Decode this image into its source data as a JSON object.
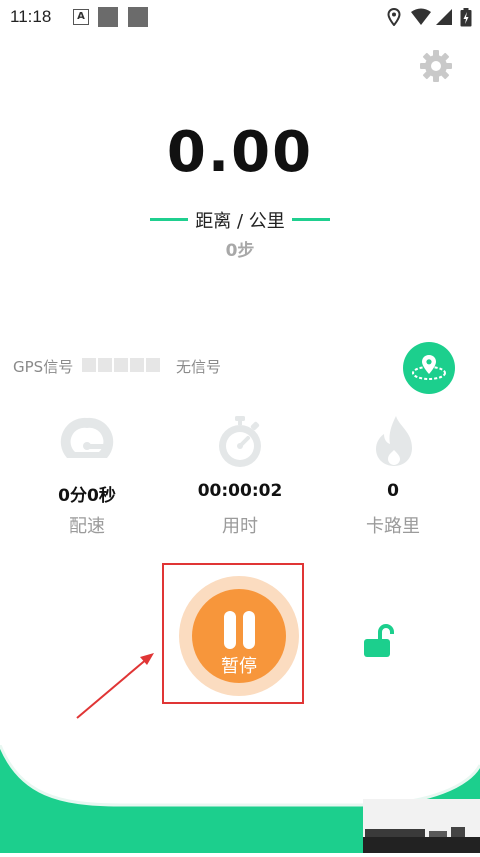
{
  "status_bar": {
    "time": "11:18",
    "keyboard_badge": "A",
    "icons": [
      "location-icon",
      "wifi-icon",
      "signal-icon",
      "battery-icon"
    ]
  },
  "settings": {
    "icon": "gear-icon"
  },
  "distance": {
    "value": "0.00",
    "unit_label": "距离 / 公里",
    "steps": "0步"
  },
  "gps": {
    "label": "GPS信号",
    "status": "无信号",
    "signal_level": 0,
    "signal_max": 5
  },
  "stats": [
    {
      "value": "0分0秒",
      "label": "配速",
      "icon": "speedometer-icon"
    },
    {
      "value": "00:00:02",
      "label": "用时",
      "icon": "stopwatch-icon"
    },
    {
      "value": "0",
      "label": "卡路里",
      "icon": "flame-icon"
    }
  ],
  "controls": {
    "pause_label": "暂停",
    "lock_icon": "unlock-icon",
    "map_icon": "map-location-icon"
  },
  "colors": {
    "accent": "#1ccf8d",
    "pause_orange": "#f7963b",
    "pause_ring": "#fbdcc0",
    "annotation_red": "#e03535"
  }
}
